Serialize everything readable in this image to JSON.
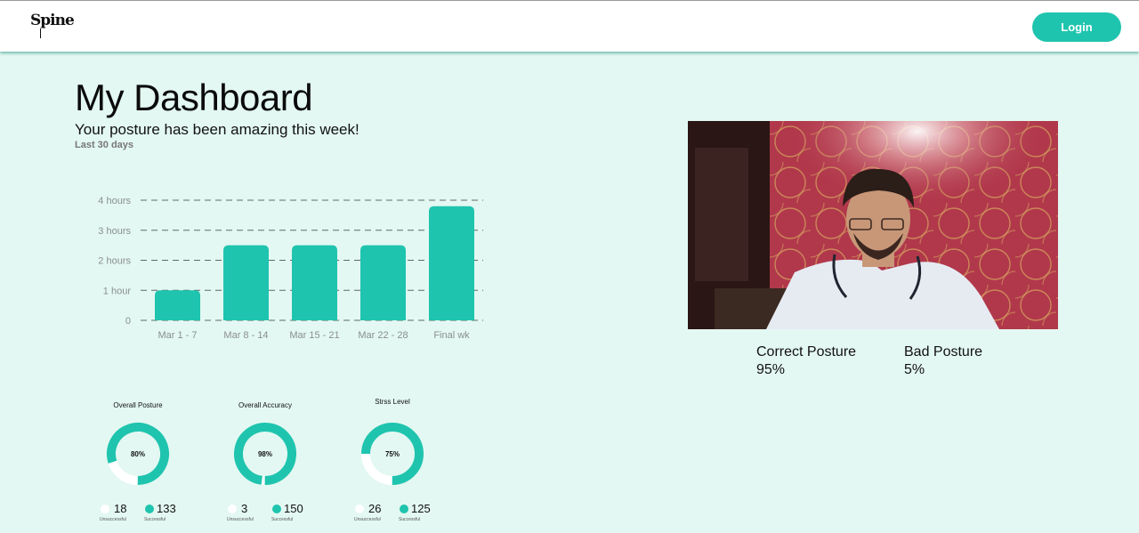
{
  "header": {
    "logo_text": "Spine",
    "login_label": "Login"
  },
  "dashboard": {
    "title": "My Dashboard",
    "subtitle": "Your posture has been amazing this week!",
    "period": "Last 30 days"
  },
  "chart_data": {
    "type": "bar",
    "categories": [
      "Mar 1 - 7",
      "Mar 8 - 14",
      "Mar 15 - 21",
      "Mar 22 - 28",
      "Final wk"
    ],
    "values": [
      1.0,
      2.5,
      2.5,
      2.5,
      3.8
    ],
    "y_ticks": [
      {
        "value": 0,
        "label": "0"
      },
      {
        "value": 1,
        "label": "1 hour"
      },
      {
        "value": 2,
        "label": "2 hours"
      },
      {
        "value": 3,
        "label": "3 hours"
      },
      {
        "value": 4,
        "label": "4 hours"
      }
    ],
    "ylim": [
      0,
      4
    ],
    "grid": true,
    "color": "#1fc4ae"
  },
  "donuts": [
    {
      "title": "Overall Posture",
      "percent": 80,
      "percent_label": "80%",
      "unsuccessful": "18",
      "successful": "133",
      "unsuccessful_label": "Unsuccessful",
      "successful_label": "Successful"
    },
    {
      "title": "Overall Accuracy",
      "percent": 98,
      "percent_label": "98%",
      "unsuccessful": "3",
      "successful": "150",
      "unsuccessful_label": "Unsuccessful",
      "successful_label": "Successful"
    },
    {
      "title": "Strss Level",
      "percent": 75,
      "percent_label": "75%",
      "unsuccessful": "26",
      "successful": "125",
      "unsuccessful_label": "Unsuccessful",
      "successful_label": "Successful"
    }
  ],
  "posture_stats": {
    "correct_label": "Correct Posture",
    "correct_value": "95%",
    "bad_label": "Bad Posture",
    "bad_value": "5%"
  },
  "colors": {
    "accent": "#1fc4ae",
    "background": "#e3f8f2",
    "ring_track": "#ffffff"
  }
}
